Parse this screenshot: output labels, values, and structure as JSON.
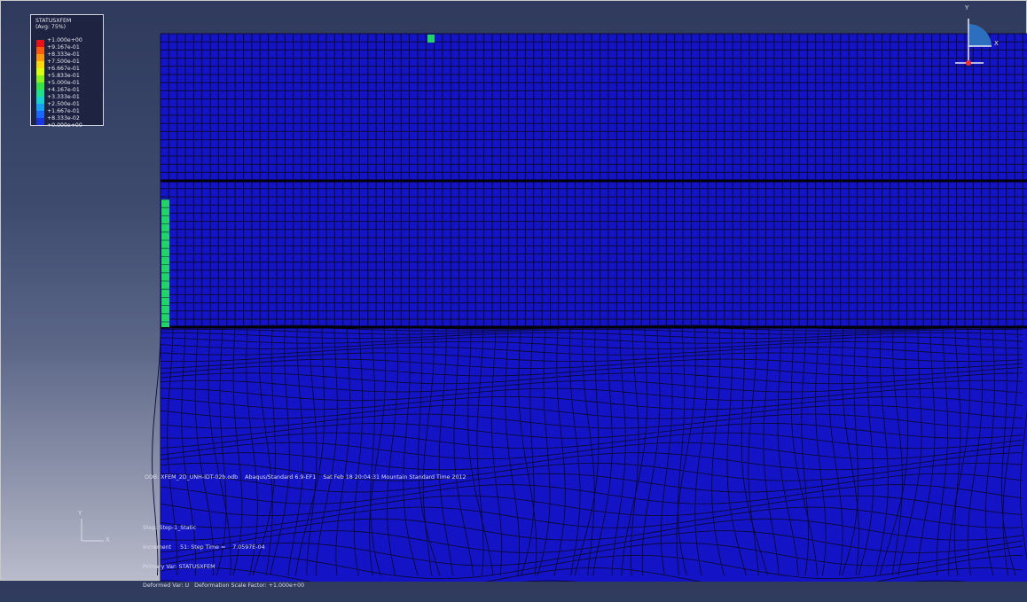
{
  "legend": {
    "title": "STATUSXFEM",
    "avg": "(Avg: 75%)",
    "values": [
      "+1.000e+00",
      "+9.167e-01",
      "+8.333e-01",
      "+7.500e-01",
      "+6.667e-01",
      "+5.833e-01",
      "+5.000e-01",
      "+4.167e-01",
      "+3.333e-01",
      "+2.500e-01",
      "+1.667e-01",
      "+8.333e-02",
      "+0.000e+00"
    ],
    "colors": [
      "#e8121a",
      "#ff5a10",
      "#ff9a10",
      "#ffd810",
      "#d8ff10",
      "#8cf020",
      "#3ae048",
      "#20e08c",
      "#18d0d0",
      "#1aa0f0",
      "#1a66ff",
      "#1a36e0",
      "#1414c8"
    ]
  },
  "mesh": {
    "background_color": "#1414c6",
    "line_color": "#0a0a38",
    "boundary_color": "#000000",
    "crack_color": "#22d36a"
  },
  "odb_line": "ODB: XFEM_2D_UNH-IDT-02b.odb    Abaqus/Standard 6.9-EF1    Sat Feb 18 20:04:31 Mountain Standard Time 2012",
  "step_info": {
    "step": "Step: Step-1_Static",
    "increment": "Increment     51: Step Time =    7.0597E-04",
    "primary_var": "Primary Var: STATUSXFEM",
    "deformed_var": "Deformed Var: U   Deformation Scale Factor: +1.000e+00"
  },
  "triad_top": {
    "y_label": "Y",
    "x_label": "X"
  },
  "triad_bottom": {
    "y_label": "Y",
    "x_label": "X"
  }
}
